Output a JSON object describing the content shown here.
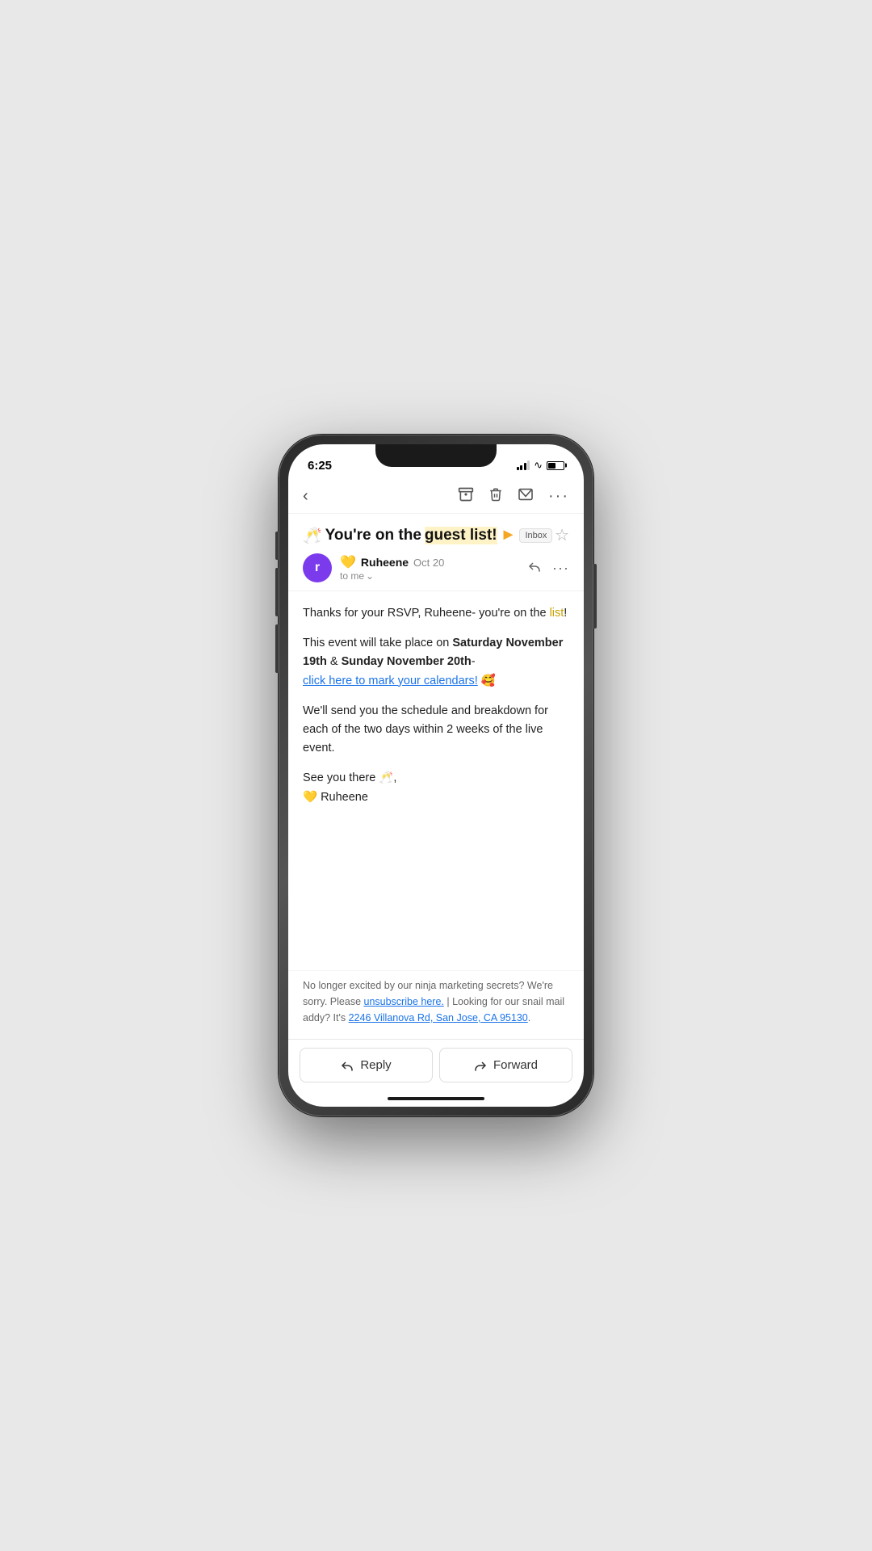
{
  "status": {
    "time": "6:25",
    "signal_bars": [
      3,
      6,
      9,
      11
    ],
    "battery_percent": 50
  },
  "toolbar": {
    "back_label": "‹",
    "archive_icon": "⊡",
    "trash_icon": "🗑",
    "mail_icon": "✉",
    "more_icon": "···"
  },
  "email": {
    "subject_emoji": "🥂",
    "subject_text": "You're on the ",
    "subject_highlight": "guest list!",
    "subject_arrow": "▶",
    "inbox_label": "Inbox",
    "sender_initial": "r",
    "sender_heart": "💛",
    "sender_name": "Ruheene",
    "sender_date": "Oct 20",
    "to_label": "to me",
    "body_line1": "Thanks for your RSVP, Ruheene- you're on the ",
    "body_link1": "list",
    "body_line1_end": "!",
    "body_line2_prefix": "This event will take place on ",
    "body_bold1": "Saturday November 19th",
    "body_line2_mid": " & ",
    "body_bold2": "Sunday November 20th",
    "body_line2_suffix": "-",
    "calendar_link": "click here to mark your calendars!",
    "calendar_emoji": "🥰",
    "body_line3": "We'll send you the schedule and breakdown for each of the two days within 2 weeks of the live event.",
    "body_closing": "See you there 🥂,",
    "body_closing2": "💛 Ruheene",
    "footer_line1": "No longer excited by our ninja marketing secrets? We're sorry. Please ",
    "footer_unsubscribe": "unsubscribe here.",
    "footer_mid": "  |  Looking for our snail mail addy?  It's ",
    "footer_address": "2246 Villanova Rd, San Jose, CA 95130",
    "footer_end": "."
  },
  "actions": {
    "reply_label": "Reply",
    "forward_label": "Forward"
  }
}
